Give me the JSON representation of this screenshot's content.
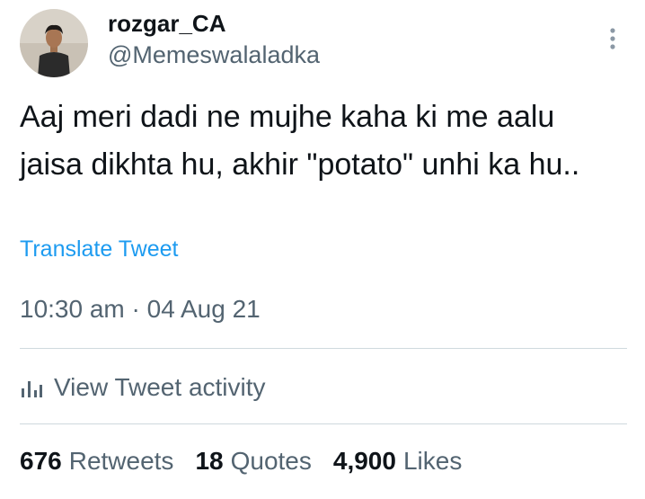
{
  "author": {
    "display_name": "rozgar_CA",
    "handle": "@Memeswalaladka",
    "avatar_icon": "user-avatar"
  },
  "menu": {
    "icon": "more-vertical-icon"
  },
  "tweet": {
    "text": "Aaj meri dadi ne mujhe kaha ki me aalu jaisa dikhta hu, akhir \"potato\" unhi ka hu..",
    "translate_label": "Translate Tweet",
    "timestamp": "10:30 am · 04 Aug 21"
  },
  "activity": {
    "icon": "bar-chart-icon",
    "label": "View Tweet activity"
  },
  "stats": {
    "retweets_count": "676",
    "retweets_label": "Retweets",
    "quotes_count": "18",
    "quotes_label": "Quotes",
    "likes_count": "4,900",
    "likes_label": "Likes"
  },
  "colors": {
    "link": "#1d9bf0",
    "secondary_text": "#536471",
    "primary_text": "#0f1419",
    "divider": "#cfd9de"
  }
}
